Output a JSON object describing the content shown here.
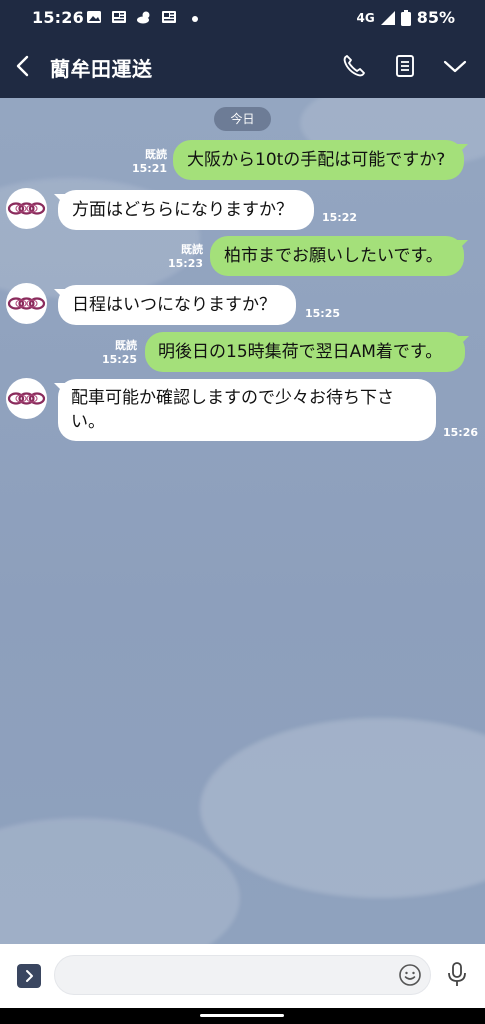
{
  "status_bar": {
    "time": "15:26",
    "network": "4G",
    "battery": "85%"
  },
  "header": {
    "title": "藺牟田運送"
  },
  "date_separator": "今日",
  "messages": [
    {
      "side": "me",
      "text": "大阪から10tの手配は可能ですか?",
      "read": "既読",
      "time": "15:21"
    },
    {
      "side": "them",
      "text": "方面はどちらになりますか？",
      "time": "15:22"
    },
    {
      "side": "me",
      "text": "柏市までお願いしたいです。",
      "read": "既読",
      "time": "15:23"
    },
    {
      "side": "them",
      "text": "日程はいつになりますか？",
      "time": "15:25"
    },
    {
      "side": "me",
      "text": "明後日の15時集荷で翌日AM着です。",
      "read": "既読",
      "time": "15:25"
    },
    {
      "side": "them",
      "text": "配車可能か確認しますので少々お待ち下さい。",
      "time": "15:26"
    }
  ],
  "input": {
    "value": "",
    "placeholder": ""
  },
  "colors": {
    "header_bg": "#1f2a42",
    "chat_bg": "#8c9fbd",
    "my_bubble": "#a4e07a",
    "their_bubble": "#ffffff",
    "avatar_logo": "#8a2b5c"
  },
  "icons": [
    "back-arrow-icon",
    "phone-icon",
    "notes-icon",
    "chevron-down-icon",
    "expand-icon",
    "emoji-icon",
    "mic-icon"
  ]
}
